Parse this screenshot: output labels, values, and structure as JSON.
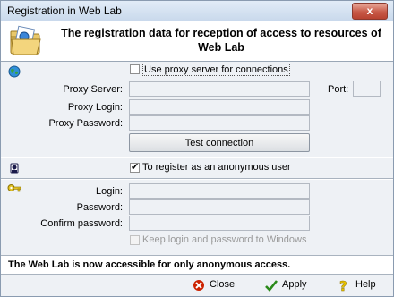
{
  "window": {
    "title": "Registration in Web Lab",
    "close_glyph": "x"
  },
  "header": {
    "title": "The registration data for reception of access to resources of Web Lab",
    "icon": "folder-letter-icon"
  },
  "proxy": {
    "icon": "globe-icon",
    "use_proxy_label": "Use proxy server for connections",
    "use_proxy_checked": false,
    "server_label": "Proxy Server:",
    "server_value": "",
    "port_label": "Port:",
    "port_value": "",
    "login_label": "Proxy Login:",
    "login_value": "",
    "password_label": "Proxy Password:",
    "password_value": "",
    "test_button": "Test connection"
  },
  "anonymous": {
    "icon": "user-icon",
    "label": "To register as an anonymous user",
    "checked": true
  },
  "credentials": {
    "icon": "key-icon",
    "login_label": "Login:",
    "login_value": "",
    "password_label": "Password:",
    "password_value": "",
    "confirm_label": "Confirm password:",
    "confirm_value": "",
    "keep_label": "Keep login and password to Windows",
    "keep_checked": false
  },
  "status": "The Web Lab is now accessible for only anonymous access.",
  "footer": {
    "close": {
      "label": "Close",
      "icon": "close-icon"
    },
    "apply": {
      "label": "Apply",
      "icon": "checkmark-icon"
    },
    "help": {
      "label": "Help",
      "icon": "help-icon"
    }
  },
  "colors": {
    "accent_red": "#cc2200",
    "check_green": "#2a8a1a",
    "help_yellow": "#e8c200"
  }
}
